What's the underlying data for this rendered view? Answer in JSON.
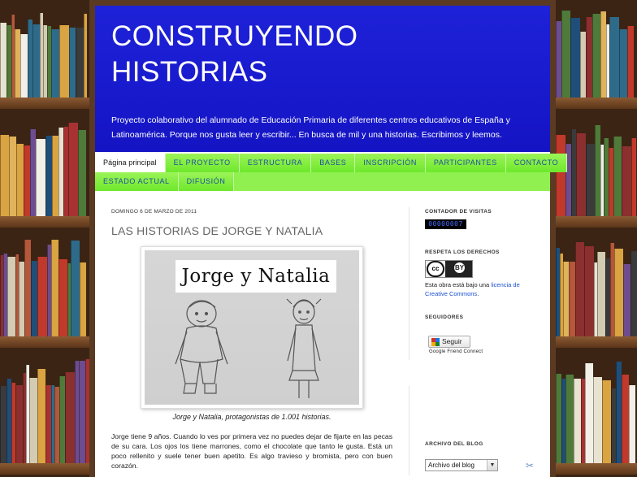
{
  "blog": {
    "title_line1": "CONSTRUYENDO",
    "title_line2": "HISTORIAS",
    "description": "Proyecto colaborativo del alumnado de Educación Primaria de diferentes centros educativos de España y Latinoamérica. Porque nos gusta leer y escribir... En busca de mil y una historias. Escribimos y leemos."
  },
  "nav": {
    "row1": [
      "Página principal",
      "EL PROYECTO",
      "ESTRUCTURA",
      "BASES",
      "INSCRIPCIÓN",
      "PARTICIPANTES",
      "CONTACTO"
    ],
    "row2": [
      "ESTADO ACTUAL",
      "DIFUSIÓN"
    ],
    "active": "Página principal"
  },
  "post": {
    "date": "DOMINGO 6 DE MARZO DE 2011",
    "title": "LAS HISTORIAS DE JORGE Y NATALIA",
    "image_label": "Jorge y Natalia",
    "caption": "Jorge y Natalia,  protagonistas de 1.001 historias.",
    "body": "Jorge tiene 9 años. Cuando lo ves por primera vez no puedes dejar de fijarte en las pecas de su cara. Los ojos los tiene marrones, como el chocolate que tanto le gusta. Está un poco rellenito y suele tener buen apetito. Es algo travieso y bromista, pero con buen corazón."
  },
  "sidebar": {
    "counter_title": "CONTADOR DE VISITAS",
    "counter_value": "00000007",
    "rights_title": "RESPETA LOS DERECHOS",
    "cc_text_prefix": "Esta obra está bajo una ",
    "cc_link": "licencia de Creative Commons",
    "cc_text_suffix": ".",
    "cc_badge_by": "BY",
    "followers_title": "SEGUIDORES",
    "follow_label": "Seguir",
    "gfc_label": "Google Friend Connect",
    "archive_title": "ARCHIVO DEL BLOG",
    "archive_select": "Archivo del blog"
  },
  "icons": {
    "cc_logo": "creative-commons-icon",
    "by_logo": "attribution-icon",
    "google": "google-icon",
    "dropdown": "chevron-down-icon",
    "tools": "wrench-icon"
  },
  "colors": {
    "header_blue": "#1a1ad0",
    "nav_green": "#7fee3a",
    "nav_text": "#1b4fa0"
  }
}
